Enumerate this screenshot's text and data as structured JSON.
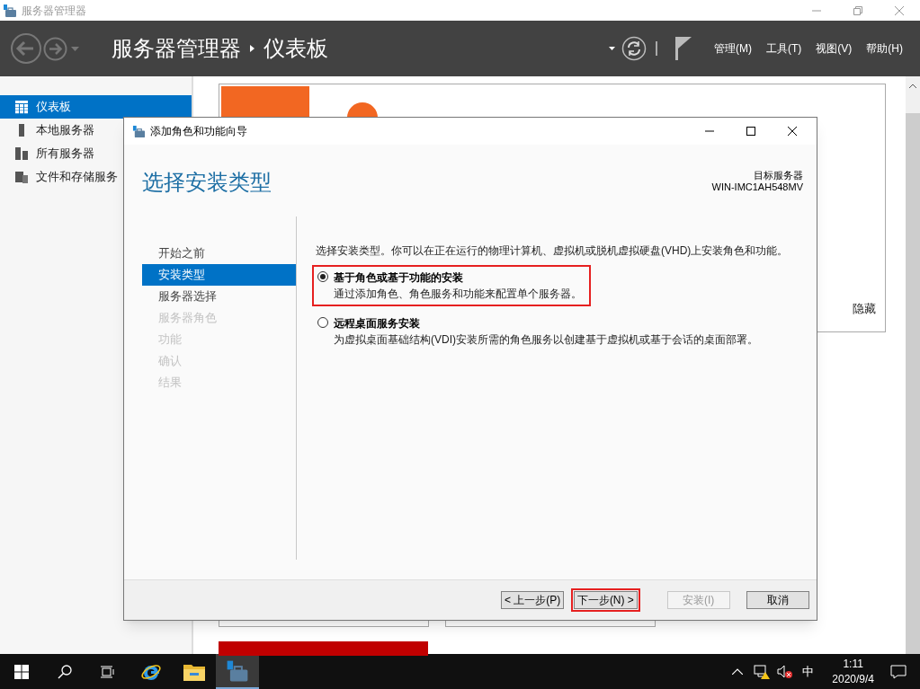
{
  "window": {
    "title": "服务器管理器"
  },
  "header": {
    "breadcrumb": [
      "服务器管理器",
      "仪表板"
    ],
    "menus": [
      "管理(M)",
      "工具(T)",
      "视图(V)",
      "帮助(H)"
    ]
  },
  "sidebar": {
    "items": [
      {
        "label": "仪表板",
        "selected": true,
        "kind": "grid"
      },
      {
        "label": "本地服务器",
        "selected": false,
        "kind": "server"
      },
      {
        "label": "所有服务器",
        "selected": false,
        "kind": "servers"
      },
      {
        "label": "文件和存储服务",
        "selected": false,
        "kind": "files"
      }
    ]
  },
  "background": {
    "hide_link": "隐藏"
  },
  "dialog": {
    "title": "添加角色和功能向导",
    "heading": "选择安装类型",
    "target_label": "目标服务器",
    "target_server": "WIN-IMC1AH548MV",
    "steps": [
      {
        "label": "开始之前",
        "selected": false,
        "disabled": false
      },
      {
        "label": "安装类型",
        "selected": true,
        "disabled": false
      },
      {
        "label": "服务器选择",
        "selected": false,
        "disabled": false
      },
      {
        "label": "服务器角色",
        "selected": false,
        "disabled": true
      },
      {
        "label": "功能",
        "selected": false,
        "disabled": true
      },
      {
        "label": "确认",
        "selected": false,
        "disabled": true
      },
      {
        "label": "结果",
        "selected": false,
        "disabled": true
      }
    ],
    "intro": "选择安装类型。你可以在正在运行的物理计算机、虚拟机或脱机虚拟硬盘(VHD)上安装角色和功能。",
    "options": [
      {
        "title": "基于角色或基于功能的安装",
        "description": "通过添加角色、角色服务和功能来配置单个服务器。",
        "selected": true,
        "highlighted": true
      },
      {
        "title": "远程桌面服务安装",
        "description": "为虚拟桌面基础结构(VDI)安装所需的角色服务以创建基于虚拟机或基于会话的桌面部署。",
        "selected": false,
        "highlighted": false
      }
    ],
    "buttons": [
      {
        "label": "< 上一步(P)",
        "disabled": false,
        "highlighted": false
      },
      {
        "label": "下一步(N) >",
        "disabled": false,
        "highlighted": true
      },
      {
        "label": "安装(I)",
        "disabled": true,
        "highlighted": false
      },
      {
        "label": "取消",
        "disabled": false,
        "highlighted": false
      }
    ]
  },
  "taskbar": {
    "ime": "中",
    "time": "1:11",
    "date": "2020/9/4"
  }
}
